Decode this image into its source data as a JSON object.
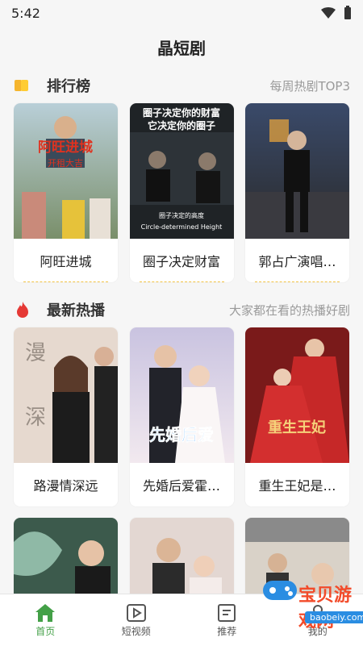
{
  "status": {
    "time": "5:42"
  },
  "header": {
    "title": "晶短剧"
  },
  "sections": [
    {
      "title": "排行榜",
      "subtitle": "每周热剧TOP3",
      "icon": "ranking-icon",
      "items": [
        {
          "label": "阿旺进城",
          "poster_text": "阿旺进城 开租大吉"
        },
        {
          "label": "圈子决定财富",
          "poster_text": "圈子决定你的财富 它决定你的圈子",
          "poster_caption": "圈子决定的高度 Circle-determined Height"
        },
        {
          "label": "郭占广演唱…"
        }
      ]
    },
    {
      "title": "最新热播",
      "subtitle": "大家都在看的热播好剧",
      "icon": "fire-icon",
      "items": [
        {
          "label": "路漫情深远",
          "poster_text": "漫 深"
        },
        {
          "label": "先婚后爱霍…",
          "poster_text": "先婚后爱"
        },
        {
          "label": "重生王妃是…",
          "poster_text": "重生王妃"
        }
      ]
    },
    {
      "items": [
        {
          "label": ""
        },
        {
          "label": ""
        },
        {
          "label": ""
        }
      ]
    }
  ],
  "nav": [
    {
      "label": "首页",
      "icon": "home-icon",
      "active": true
    },
    {
      "label": "短视频",
      "icon": "video-icon",
      "active": false
    },
    {
      "label": "推荐",
      "icon": "recommend-icon",
      "active": false
    },
    {
      "label": "我的",
      "icon": "profile-icon",
      "active": false
    }
  ],
  "watermark": {
    "text": "宝贝游戏网",
    "url": "baobeiy.com"
  },
  "colors": {
    "accent": "#43a047",
    "gold": "#f5b52e",
    "red": "#e53935"
  }
}
